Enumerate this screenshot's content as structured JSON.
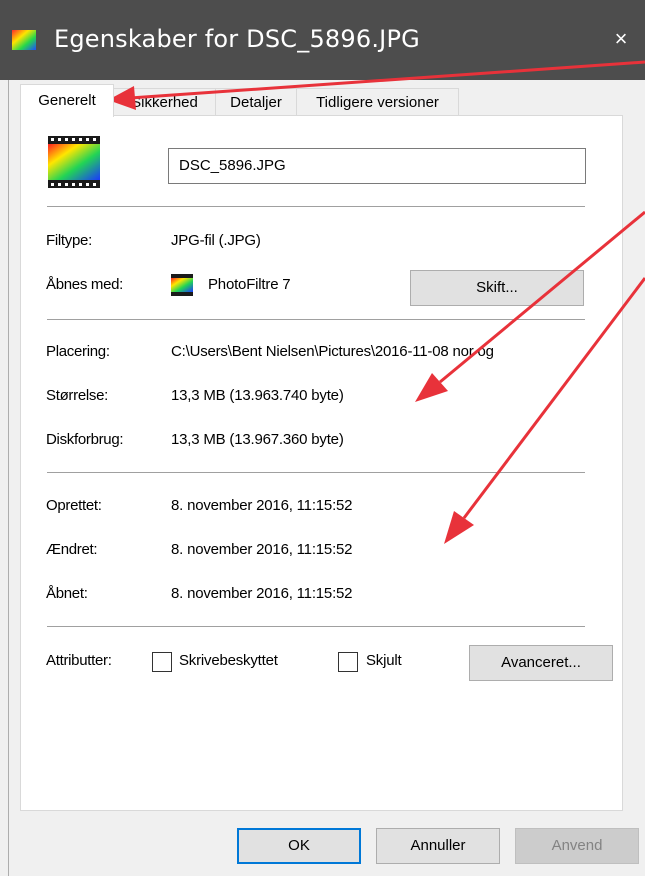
{
  "window": {
    "title": "Egenskaber for DSC_5896.JPG",
    "close_glyph": "×"
  },
  "tabs": [
    {
      "label": "Generelt",
      "active": true
    },
    {
      "label": "Sikkerhed",
      "active": false
    },
    {
      "label": "Detaljer",
      "active": false
    },
    {
      "label": "Tidligere versioner",
      "active": false
    }
  ],
  "general": {
    "filename": "DSC_5896.JPG",
    "filetype_label": "Filtype:",
    "filetype_value": "JPG-fil (.JPG)",
    "opens_with_label": "Åbnes med:",
    "opens_with_value": "PhotoFiltre 7",
    "change_button": "Skift...",
    "location_label": "Placering:",
    "location_value": "C:\\Users\\Bent Nielsen\\Pictures\\2016-11-08 nor og",
    "size_label": "Størrelse:",
    "size_value": "13,3 MB (13.963.740 byte)",
    "disk_label": "Diskforbrug:",
    "disk_value": "13,3 MB (13.967.360 byte)",
    "created_label": "Oprettet:",
    "created_value": "8. november 2016, 11:15:52",
    "modified_label": "Ændret:",
    "modified_value": "8. november 2016, 11:15:52",
    "accessed_label": "Åbnet:",
    "accessed_value": "8. november 2016, 11:15:52",
    "attributes_label": "Attributter:",
    "readonly_label": "Skrivebeskyttet",
    "hidden_label": "Skjult",
    "advanced_button": "Avanceret..."
  },
  "footer": {
    "ok": "OK",
    "cancel": "Annuller",
    "apply": "Anvend"
  },
  "colors": {
    "titlebar": "#4d4d4d",
    "annotation_arrow": "#e8323a",
    "default_button_border": "#0078d7"
  },
  "icons": {
    "title": "image-file-icon",
    "file": "image-file-icon",
    "app": "photofiltre-icon"
  }
}
